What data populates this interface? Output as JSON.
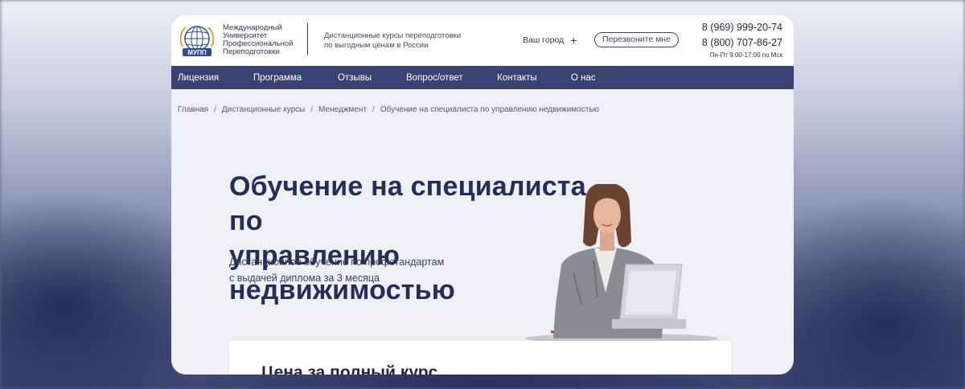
{
  "header": {
    "logo_label": "МУПП",
    "logo_text": [
      "Международный",
      "Университет",
      "Профессиональной",
      "Переподготовки"
    ],
    "tagline": [
      "Дистанционные курсы переподготовки",
      "по выгодным ценам в России"
    ],
    "city_label": "Ваш город",
    "city_plus": "+",
    "callback_button": "Перезвоните мне",
    "phone1": "8 (969) 999-20-74",
    "phone2": "8 (800) 707-86-27",
    "hours": "Пн-Пт 9:00-17:00 по Мск"
  },
  "nav": {
    "items": [
      "Лицензия",
      "Программа",
      "Отзывы",
      "Вопрос/ответ",
      "Контакты",
      "О нас"
    ]
  },
  "breadcrumbs": {
    "items": [
      "Главная",
      "Дистанционные курсы",
      "Менеджмент",
      "Обучение на специалиста по управлению недвижимостью"
    ],
    "separator": "/"
  },
  "hero": {
    "title_line1": "Обучение на специалиста по",
    "title_line2": "управлению недвижимостью",
    "subtitle_line1": "Дистанционное обучение по профстандартам",
    "subtitle_line2": "с выдачей диплома за 3 месяца"
  },
  "price": {
    "title": "Цена за полный курс"
  },
  "colors": {
    "nav_bg": "#3a4173",
    "title": "#262d5c",
    "accent": "#3d4478"
  }
}
